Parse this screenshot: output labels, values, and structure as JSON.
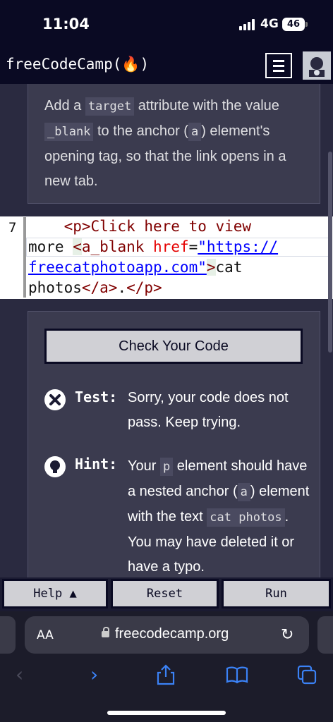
{
  "status_bar": {
    "time": "11:04",
    "network": "4G",
    "battery": "46"
  },
  "nav": {
    "brand": "freeCodeCamp(🔥)"
  },
  "description": {
    "p1": "Add a ",
    "code1": "target",
    "p2": " attribute with the value ",
    "code2": "_blank",
    "p3": " to the anchor (",
    "code3": "a",
    "p4": ") element's opening tag, so that the link opens in a new tab."
  },
  "editor": {
    "line_number": "7",
    "l1_text": "    <p>Click here to view",
    "l2_a": "more ",
    "l2_b": "<",
    "l2_c": "a_blank",
    "l2_d": " href",
    "l2_e": "=",
    "l2_f": "\"https://",
    "l3_a": "freecatphotoapp.com\"",
    "l3_b": ">",
    "l3_c": "cat",
    "l4_a": "photos",
    "l4_b": "</a>",
    "l4_c": ".",
    "l4_d": "</p>"
  },
  "check_button": "Check Your Code",
  "test": {
    "label": "Test:",
    "text": "Sorry, your code does not pass. Keep trying."
  },
  "hint": {
    "label": "Hint:",
    "t1": "Your ",
    "c1": "p",
    "t2": " element should have a nested anchor (",
    "c2": "a",
    "t3": ") element with the text ",
    "c3": "cat photos",
    "t4": ". You may have deleted it or have a typo."
  },
  "toolbar": {
    "help": "Help ▲",
    "reset": "Reset",
    "run": "Run"
  },
  "browser": {
    "aa": "AA",
    "url": "freecodecamp.org"
  },
  "colors": {
    "nav_bg": "#0a0a23",
    "panel_bg": "#3b3b4f",
    "button_bg": "#d0d0d5",
    "accent_blue": "#3b82f6"
  }
}
